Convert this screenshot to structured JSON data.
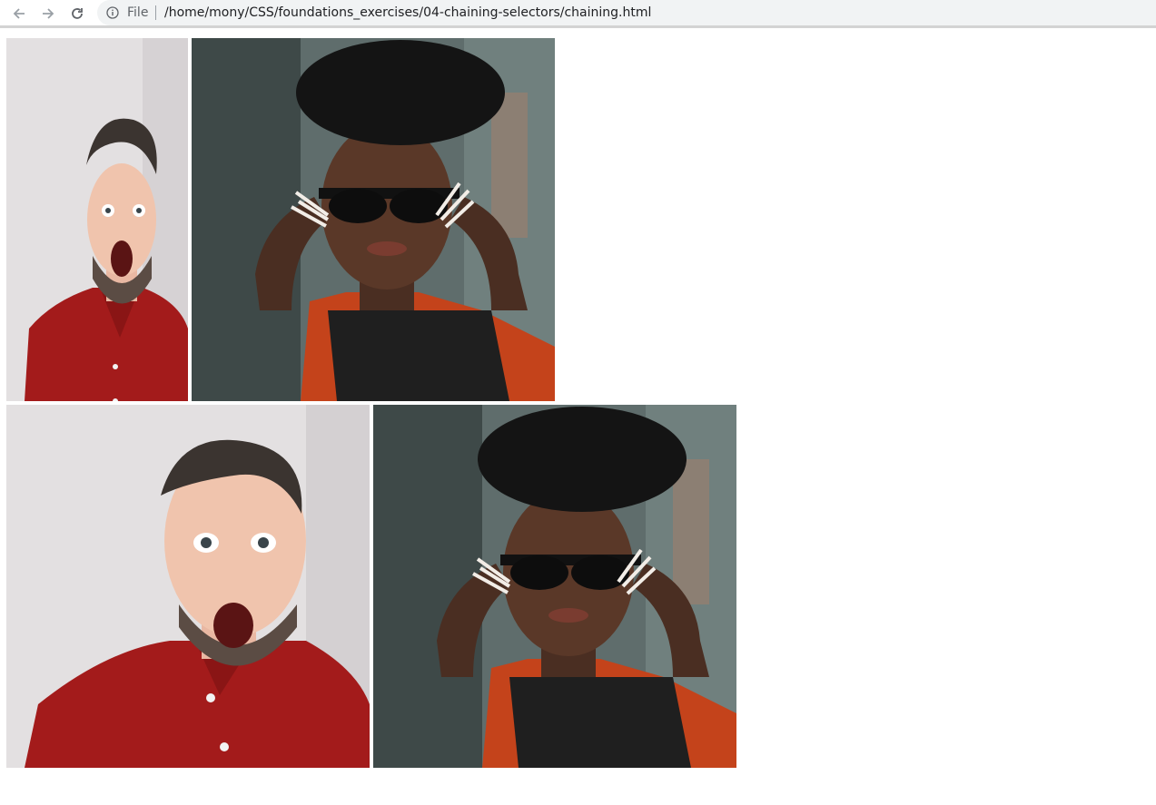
{
  "browser": {
    "scheme_label": "File",
    "url": "/home/mony/CSS/foundations_exercises/04-chaining-selectors/chaining.html",
    "icons": {
      "back": "arrow-left-icon",
      "forward": "arrow-right-icon",
      "reload": "reload-icon",
      "info": "info-icon"
    }
  },
  "page": {
    "images": [
      {
        "subject": "surprised man in red polo shirt"
      },
      {
        "subject": "woman with black beret holding sunglasses"
      },
      {
        "subject": "surprised man in red polo shirt"
      },
      {
        "subject": "woman with black beret holding sunglasses"
      }
    ]
  },
  "colors": {
    "man_shirt": "#a31b1b",
    "man_bg": "#e2dfe0",
    "woman_bg": "#5c6b6a",
    "beret": "#141414"
  }
}
